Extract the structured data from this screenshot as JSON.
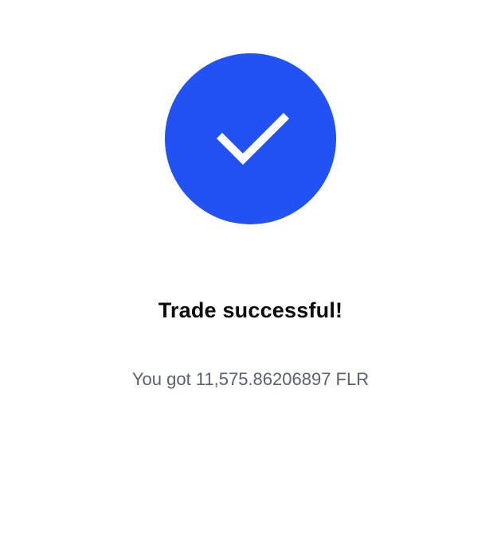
{
  "status": {
    "icon": "checkmark-icon",
    "accent_color": "#2152f4"
  },
  "result": {
    "title": "Trade successful!",
    "message": "You got 11,575.86206897 FLR"
  }
}
